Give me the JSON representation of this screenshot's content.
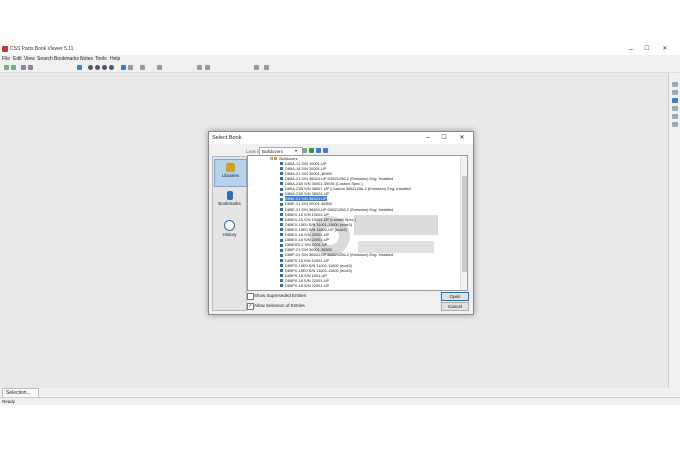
{
  "app": {
    "title": "CSS Parts Book Viewer 5.11",
    "menu": [
      "File",
      "Edit",
      "View",
      "Search",
      "Bookmarks",
      "Notes",
      "Tools",
      "Help"
    ]
  },
  "dialog": {
    "title": "Select Book",
    "look_in_label": "Look in:",
    "look_in_value": "Bulldozers",
    "places": [
      {
        "label": "Libraries",
        "active": true
      },
      {
        "label": "Bookmarks",
        "active": false
      },
      {
        "label": "History",
        "active": false
      }
    ],
    "tree_root": "Bulldozers",
    "items": [
      "D85A-12 S/N 10001-UP",
      "D85A-18 S/N 20001-UP",
      "D85A-21 S/N 30001-36500",
      "D85A-21 S/N 36524-UP D6521256-2 (Emission) Eng. Installed",
      "D85A-21B S/N 35001-35035 (Custom Spec.)",
      "D85A-21B S/N 36507-UP (Custom 36521256-2 (Emission) Eng. Installed",
      "D85A-21B S/N 36524-UP",
      "D85E-21 S/N 36524-UP",
      "D85E-21 S/N 30001-36500",
      "D85E-21 S/N 36524-UP D6521256-2 (Emission) Eng. Installed",
      "D85EX-15 S/N 10001-UP",
      "D85EX-15 S/N 10001-UP (Landfill Spec.)",
      "D85EX-15E0 S/N 11001-11600 (ecot3)",
      "D85EX-15E0 S/N 11600-UP (ecot3)",
      "D85EX-18 S/N 22001-UP",
      "D85EX-18 S/N 22001-UP",
      "D85ESS-2 S/N 2001-UP",
      "D85P-21 S/N 30001-36500",
      "D85P-21 S/N 36524-UP D6521256-2 (Emission) Eng. Installed",
      "D85PX-15 S/N 10001-UP",
      "D85PX-15E0 S/N 11001-11600 (ecot3)",
      "D85PX-15E0 S/N 11601-11600 (ecot3)",
      "D85PX-15 S/N 1001-UP",
      "D85PX-18 S/N 22001-UP",
      "D85PX-18 S/N 22001-UP"
    ],
    "selected_index": 7,
    "show_superseded": "Show Superseded Entries",
    "allow_selection": "Allow Selection of Entries",
    "open_label": "Open",
    "cancel_label": "Cancel"
  },
  "bottom": {
    "selection_tab": "Selection...",
    "status": "Ready"
  },
  "colors": {
    "accent": "#0078d7",
    "selected_row": "#3a7bd5",
    "item_icon": "#2a6fb5"
  },
  "window_controls": {
    "minimize": "–",
    "maximize": "☐",
    "close": "✕"
  }
}
